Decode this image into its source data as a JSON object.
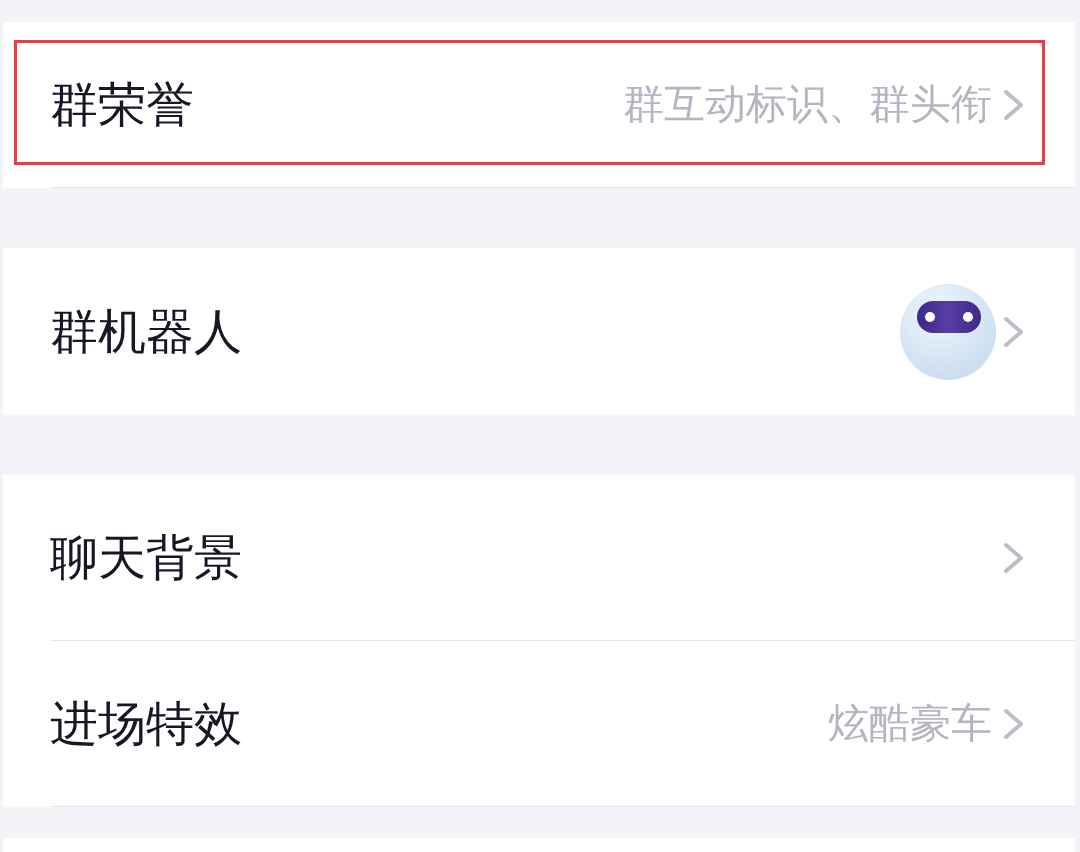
{
  "sections": [
    {
      "rows": [
        {
          "kind": "value",
          "label": "群荣誉",
          "value": "群互动标识、群头衔",
          "highlighted": true,
          "divider": true
        }
      ]
    },
    {
      "rows": [
        {
          "kind": "avatar",
          "label": "群机器人",
          "highlighted": false,
          "divider": false
        }
      ]
    },
    {
      "rows": [
        {
          "kind": "plain",
          "label": "聊天背景",
          "highlighted": false,
          "divider": true
        },
        {
          "kind": "value",
          "label": "进场特效",
          "value": "炫酷豪车",
          "highlighted": false,
          "divider": true
        }
      ]
    }
  ]
}
